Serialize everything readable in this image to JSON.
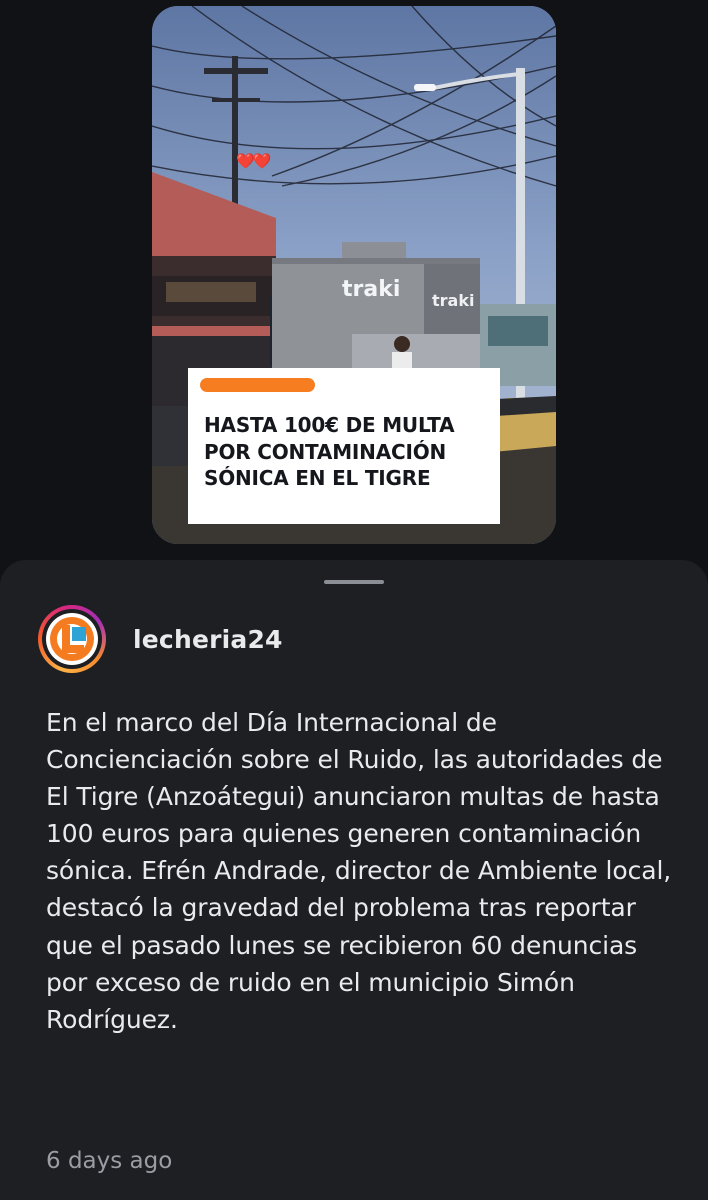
{
  "post": {
    "image": {
      "headline": "HASTA 100€ DE MULTA POR CONTAMINACIÓN SÓNICA EN EL TIGRE",
      "store_sign": "traki",
      "store_sign_2": "traki",
      "sticker": "❤️❤️",
      "accent_color": "#f77d21"
    },
    "author": {
      "username": "lecheria24",
      "avatar_letter": "L"
    },
    "caption": "En el marco del Día Internacional de Concienciación sobre el Ruido, las autoridades de El Tigre (Anzoátegui) anunciaron multas de hasta 100 euros para quienes generen contaminación sónica. Efrén Andrade, director de Ambiente local, destacó la gravedad del problema tras reportar que el pasado lunes se recibieron 60 denuncias por exceso de ruido en el municipio Simón Rodríguez.",
    "timestamp": "6 days ago"
  },
  "colors": {
    "background": "#111216",
    "sheet": "#1d1f23",
    "text": "#e9eaec",
    "muted": "#9a9da3"
  }
}
